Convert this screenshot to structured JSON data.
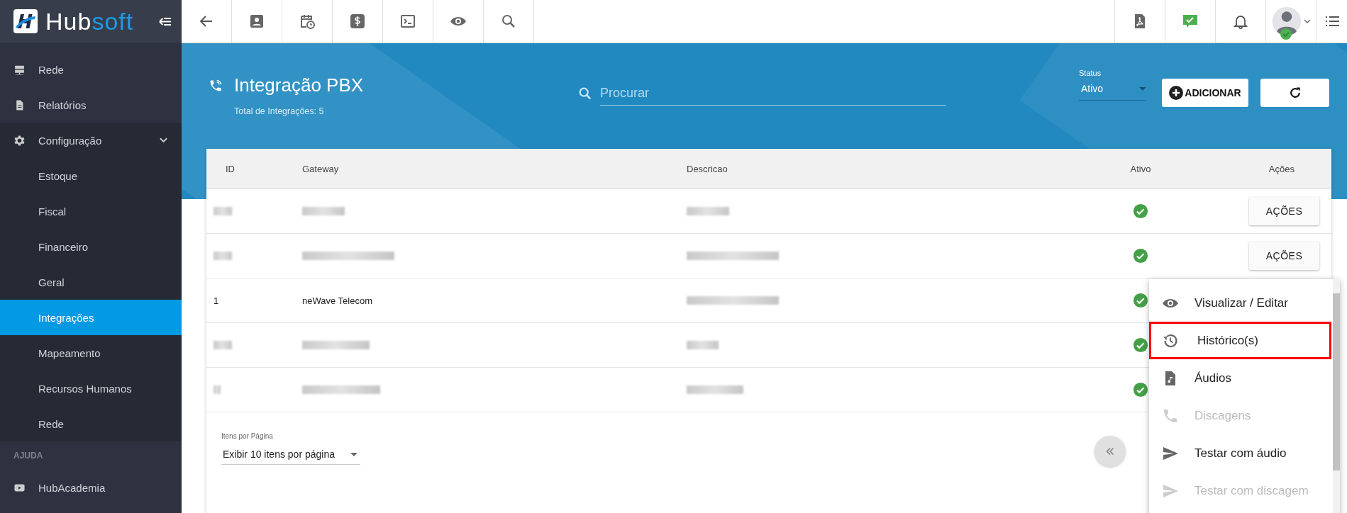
{
  "brand": {
    "part_a": "Hub",
    "part_b": "soft"
  },
  "user": {
    "online": true
  },
  "sidebar": {
    "items": [
      {
        "label": "Rede",
        "kind": "server",
        "selected": false
      },
      {
        "label": "Relatórios",
        "kind": "file",
        "selected": false
      },
      {
        "label": "Configuração",
        "kind": "gear",
        "selected": false,
        "expanded": true,
        "children": [
          {
            "label": "Estoque",
            "selected": false
          },
          {
            "label": "Fiscal",
            "selected": false
          },
          {
            "label": "Financeiro",
            "selected": false
          },
          {
            "label": "Geral",
            "selected": false
          },
          {
            "label": "Integrações",
            "selected": true
          },
          {
            "label": "Mapeamento",
            "selected": false
          },
          {
            "label": "Recursos Humanos",
            "selected": false
          },
          {
            "label": "Rede",
            "selected": false
          }
        ]
      }
    ],
    "section": "AJUDA",
    "help_items": [
      {
        "label": "HubAcademia",
        "kind": "video",
        "selected": false
      }
    ]
  },
  "header": {
    "title": "Integração PBX",
    "subtitle": "Total de Integrações: 5",
    "search_placeholder": "Procurar",
    "status_label": "Status",
    "status_value": "Ativo",
    "add_button": "ADICIONAR"
  },
  "table": {
    "columns": [
      "ID",
      "Gateway",
      "Descricao",
      "Ativo",
      "Ações"
    ],
    "rows": [
      {
        "active": true,
        "action_label": "AÇÕES"
      },
      {
        "active": true,
        "action_label": "AÇÕES"
      },
      {
        "id": "1",
        "gateway": "neWave Telecom",
        "active": true
      },
      {
        "active": true
      },
      {
        "active": true
      }
    ]
  },
  "pagination": {
    "label": "Itens por Página",
    "value": "Exibir 10 itens por página"
  },
  "action_menu": {
    "items": [
      {
        "label": "Visualizar / Editar",
        "kind": "eye",
        "disabled": false,
        "highlighted": false
      },
      {
        "label": "Histórico(s)",
        "kind": "history",
        "disabled": false,
        "highlighted": true
      },
      {
        "label": "Áudios",
        "kind": "audio",
        "disabled": false,
        "highlighted": false
      },
      {
        "label": "Discagens",
        "kind": "phone",
        "disabled": true,
        "highlighted": false
      },
      {
        "label": "Testar com áudio",
        "kind": "send",
        "disabled": false,
        "highlighted": false
      },
      {
        "label": "Testar com discagem",
        "kind": "send",
        "disabled": true,
        "highlighted": false
      }
    ]
  }
}
